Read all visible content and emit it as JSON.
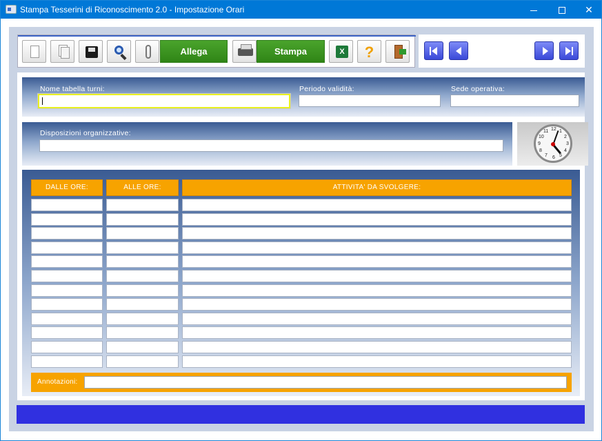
{
  "window": {
    "title": "Stampa Tesserini di Riconoscimento 2.0 - Impostazione Orari",
    "minimize_glyph": "",
    "maximize_glyph": "",
    "close_glyph": "✕"
  },
  "toolbar": {
    "attach_label": "Allega",
    "print_label": "Stampa",
    "help_glyph": "?",
    "excel_glyph": "X"
  },
  "form": {
    "shift_table_label": "Nome tabella turni:",
    "shift_table_value": "",
    "validity_label": "Periodo validità:",
    "validity_value": "",
    "site_label": "Sede operativa:",
    "site_value": "",
    "dispositions_label": "Disposizioni organizzative:",
    "dispositions_value": ""
  },
  "clock": {
    "numbers": [
      "12",
      "1",
      "2",
      "3",
      "4",
      "5",
      "6",
      "7",
      "8",
      "9",
      "10",
      "11"
    ]
  },
  "table": {
    "headers": [
      "DALLE ORE:",
      "ALLE ORE:",
      "ATTIVITA' DA SVOLGERE:"
    ],
    "rows": [
      [
        "",
        "",
        ""
      ],
      [
        "",
        "",
        ""
      ],
      [
        "",
        "",
        ""
      ],
      [
        "",
        "",
        ""
      ],
      [
        "",
        "",
        ""
      ],
      [
        "",
        "",
        ""
      ],
      [
        "",
        "",
        ""
      ],
      [
        "",
        "",
        ""
      ],
      [
        "",
        "",
        ""
      ],
      [
        "",
        "",
        ""
      ],
      [
        "",
        "",
        ""
      ],
      [
        "",
        "",
        ""
      ]
    ]
  },
  "notes": {
    "label": "Annotazioni:",
    "value": ""
  },
  "colors": {
    "titlebar": "#0078d7",
    "header_orange": "#f7a300",
    "status_blue": "#3030e0",
    "action_green": "#3a9620"
  }
}
